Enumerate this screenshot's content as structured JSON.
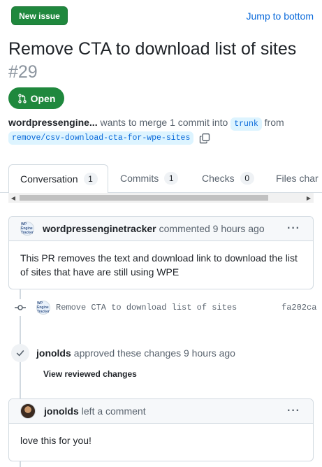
{
  "header": {
    "new_issue_label": "New issue",
    "jump_label": "Jump to bottom"
  },
  "pr": {
    "title": "Remove CTA to download list of sites",
    "number": "#29",
    "state": "Open",
    "author": "wordpressengine...",
    "merge_text": "wants to merge 1 commit into",
    "base_branch": "trunk",
    "from_text": "from",
    "head_branch": "remove/csv-download-cta-for-wpe-sites"
  },
  "tabs": [
    {
      "label": "Conversation",
      "count": "1"
    },
    {
      "label": "Commits",
      "count": "1"
    },
    {
      "label": "Checks",
      "count": "0"
    },
    {
      "label": "Files char",
      "count": ""
    }
  ],
  "comment1": {
    "author": "wordpressenginetracker",
    "action": "commented 9 hours ago",
    "avatar_text": "WP Engine Tracker",
    "body": "This PR removes the text and download link to download the list of sites that have are still using WPE"
  },
  "commit": {
    "message": "Remove CTA to download list of sites",
    "sha": "fa202ca"
  },
  "review": {
    "author": "jonolds",
    "action": "approved these changes 9 hours ago",
    "view_label": "View reviewed changes"
  },
  "comment2": {
    "author": "jonolds",
    "action": "left a comment",
    "body": "love this for you!"
  },
  "colors": {
    "green": "#1f883d",
    "link": "#0969da",
    "branch_bg": "#ddf4ff"
  }
}
